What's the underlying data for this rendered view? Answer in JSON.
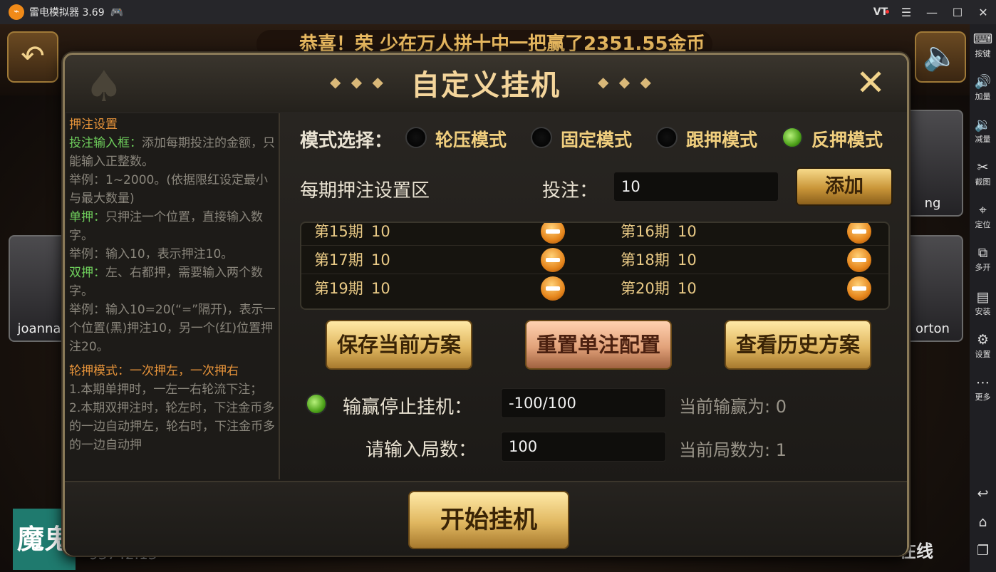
{
  "window": {
    "title": "雷电模拟器 3.69",
    "vt_label": "VT"
  },
  "sidebar": {
    "items": [
      {
        "label": "按键",
        "icon": "keyboard-icon",
        "glyph": "⌨"
      },
      {
        "label": "加量",
        "icon": "volume-up-icon",
        "glyph": "🔊"
      },
      {
        "label": "减量",
        "icon": "volume-down-icon",
        "glyph": "🔉"
      },
      {
        "label": "截图",
        "icon": "scissors-icon",
        "glyph": "✂"
      },
      {
        "label": "定位",
        "icon": "location-pin-icon",
        "glyph": "⌖"
      },
      {
        "label": "多开",
        "icon": "multi-window-icon",
        "glyph": "⧉"
      },
      {
        "label": "安装",
        "icon": "apk-install-icon",
        "glyph": "▤"
      },
      {
        "label": "设置",
        "icon": "gear-icon",
        "glyph": "⚙"
      },
      {
        "label": "更多",
        "icon": "more-icon",
        "glyph": "⋯"
      }
    ],
    "nav": {
      "back_glyph": "↩",
      "home_glyph": "⌂",
      "recent_glyph": "❐"
    }
  },
  "game": {
    "marquee": "恭喜！荣 少在万人拼十中一把赢了2351.55金币",
    "players": [
      {
        "name": "joanna"
      },
      {
        "name": "orton"
      },
      {
        "name": "ng"
      }
    ],
    "bottom_left_text": "魔鬼",
    "coins": "93742.13",
    "online_label": "在线"
  },
  "dialog": {
    "title": "自定义挂机",
    "help": {
      "section_title": "押注设置",
      "lines": [
        {
          "kind": "green",
          "lead": "投注输入框：",
          "text": "添加每期投注的金额，只能输入正整数。"
        },
        {
          "kind": "plain",
          "text": "举例：1~2000。(依据限红设定最小与最大数量)"
        },
        {
          "kind": "green",
          "lead": "单押：",
          "text": "只押注一个位置，直接输入数字。"
        },
        {
          "kind": "plain",
          "text": "举例：输入10，表示押注10。"
        },
        {
          "kind": "green",
          "lead": "双押：",
          "text": "左、右都押，需要输入两个数字。"
        },
        {
          "kind": "plain",
          "text": "举例：输入10=20(“=”隔开)，表示一个位置(黑)押注10，另一个(红)位置押注20。"
        },
        {
          "kind": "orange",
          "text": "轮押模式：一次押左，一次押右"
        },
        {
          "kind": "plain",
          "text": "1.本期单押时，一左一右轮流下注；"
        },
        {
          "kind": "plain",
          "text": "2.本期双押注时，轮左时，下注金币多的一边自动押左，轮右时，下注金币多的一边自动押"
        }
      ]
    },
    "mode": {
      "label": "模式选择：",
      "options": [
        {
          "label": "轮压模式",
          "selected": false
        },
        {
          "label": "固定模式",
          "selected": false
        },
        {
          "label": "跟押模式",
          "selected": false
        },
        {
          "label": "反押模式",
          "selected": true
        }
      ]
    },
    "bet_area_label": "每期押注设置区",
    "bet_label": "投注：",
    "bet_value": "10",
    "add_button": "添加",
    "periods": [
      [
        {
          "period": "第15期",
          "amount": "10"
        },
        {
          "period": "第16期",
          "amount": "10"
        }
      ],
      [
        {
          "period": "第17期",
          "amount": "10"
        },
        {
          "period": "第18期",
          "amount": "10"
        }
      ],
      [
        {
          "period": "第19期",
          "amount": "10"
        },
        {
          "period": "第20期",
          "amount": "10"
        }
      ]
    ],
    "buttons": {
      "save": "保存当前方案",
      "reset": "重置单注配置",
      "history": "查看历史方案"
    },
    "stop_label": "输赢停止挂机：",
    "stop_value": "-100/100",
    "current_winloss_label": "当前输赢为:",
    "current_winloss": "0",
    "rounds_label": "请输入局数：",
    "rounds_value": "100",
    "current_rounds_label": "当前局数为:",
    "current_rounds": "1",
    "start_button": "开始挂机"
  }
}
